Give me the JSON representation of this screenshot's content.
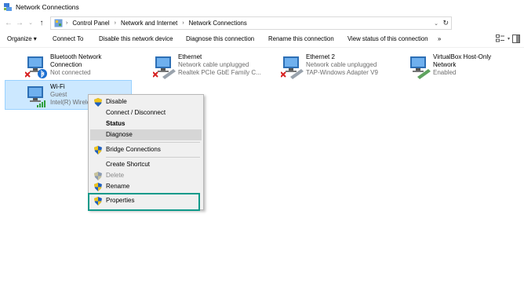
{
  "window": {
    "title": "Network Connections"
  },
  "address": {
    "crumbs": [
      "Control Panel",
      "Network and Internet",
      "Network Connections"
    ]
  },
  "commands": [
    "Organize ▾",
    "Connect To",
    "Disable this network device",
    "Diagnose this connection",
    "Rename this connection",
    "View status of this connection",
    "»"
  ],
  "connections": [
    {
      "name": "Bluetooth Network",
      "name2": "Connection",
      "status": "Not connected"
    },
    {
      "name": "Ethernet",
      "status": "Network cable unplugged",
      "adapter": "Realtek PCIe GbE Family C..."
    },
    {
      "name": "Ethernet 2",
      "status": "Network cable unplugged",
      "adapter": "TAP-Windows Adapter V9"
    },
    {
      "name": "VirtualBox Host-Only",
      "name2": "Network",
      "status": "Enabled"
    },
    {
      "name": "Wi-Fi",
      "status": "Guest",
      "adapter": "Intel(R) Wirele"
    }
  ],
  "context_menu": {
    "items": [
      "Disable",
      "Connect / Disconnect",
      "Status",
      "Diagnose",
      "Bridge Connections",
      "Create Shortcut",
      "Delete",
      "Rename",
      "Properties"
    ]
  },
  "colors": {
    "selection": "#cce8ff",
    "highlight_box": "#0f9a8a",
    "shield_blue": "#1f5fbf",
    "shield_yellow": "#f0c419"
  }
}
